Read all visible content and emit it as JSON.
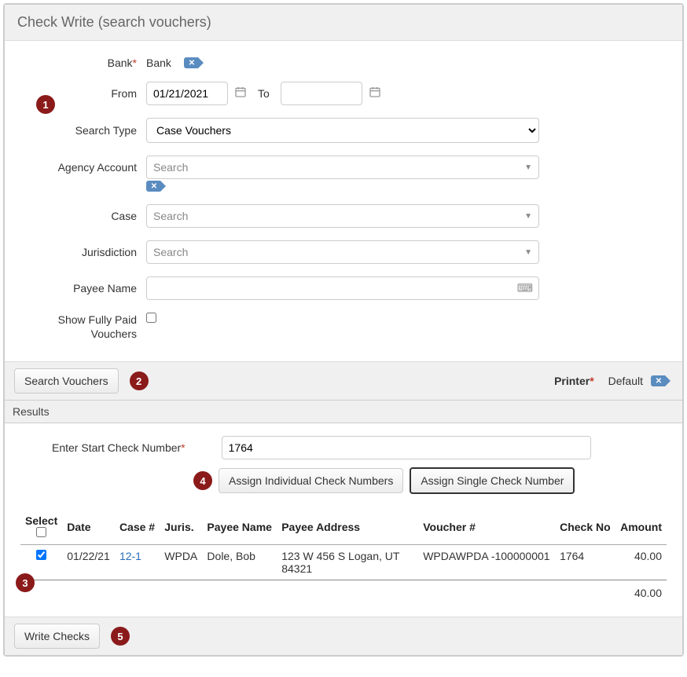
{
  "page": {
    "title": "Check Write (search vouchers)",
    "results_label": "Results"
  },
  "labels": {
    "bank": "Bank",
    "from": "From",
    "to": "To",
    "search_type": "Search Type",
    "agency_account": "Agency Account",
    "case": "Case",
    "jurisdiction": "Jurisdiction",
    "payee_name": "Payee Name",
    "show_fully_paid": "Show Fully Paid Vouchers",
    "printer": "Printer",
    "enter_start_check": "Enter Start Check Number",
    "select": "Select"
  },
  "values": {
    "bank_value": "Bank",
    "from_date": "01/21/2021",
    "to_date": "",
    "search_type": "Case Vouchers",
    "agency_account_placeholder": "Search",
    "case_placeholder": "Search",
    "jurisdiction_placeholder": "Search",
    "payee_name": "",
    "show_fully_paid": false,
    "printer_value": "Default",
    "start_check_number": "1764"
  },
  "buttons": {
    "search_vouchers": "Search Vouchers",
    "assign_individual": "Assign Individual Check Numbers",
    "assign_single": "Assign Single Check Number",
    "write_checks": "Write Checks"
  },
  "columns": {
    "date": "Date",
    "case_num": "Case #",
    "juris": "Juris.",
    "payee_name": "Payee Name",
    "payee_address": "Payee Address",
    "voucher_num": "Voucher #",
    "check_no": "Check No",
    "amount": "Amount"
  },
  "rows": [
    {
      "selected": true,
      "date": "01/22/21",
      "case": "12-1",
      "juris": "WPDA",
      "payee_name": "Dole, Bob",
      "payee_address": "123 W 456 S Logan, UT 84321",
      "voucher": "WPDAWPDA -100000001",
      "check_no": "1764",
      "amount": "40.00"
    }
  ],
  "total_amount": "40.00",
  "markers": {
    "m1": "1",
    "m2": "2",
    "m3": "3",
    "m4": "4",
    "m5": "5"
  }
}
